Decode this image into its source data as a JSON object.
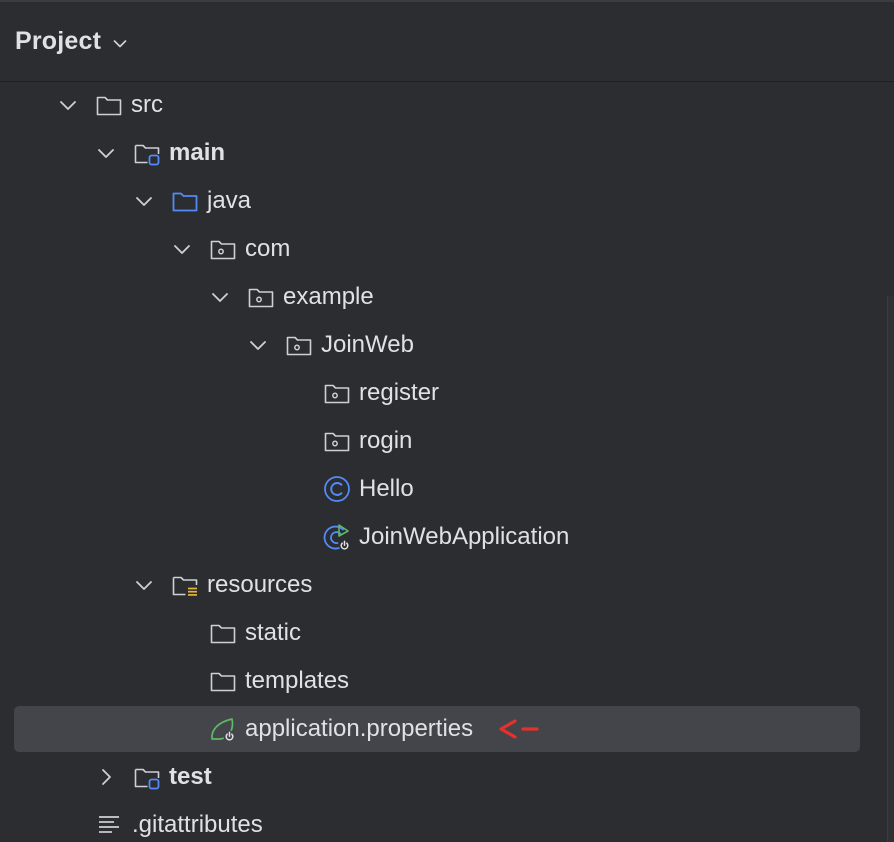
{
  "panel": {
    "title": "Project"
  },
  "tree": {
    "src": "src",
    "main": "main",
    "java": "java",
    "com": "com",
    "example": "example",
    "joinweb": "JoinWeb",
    "register": "register",
    "rogin": "rogin",
    "hello": "Hello",
    "joinwebapp": "JoinWebApplication",
    "resources": "resources",
    "static": "static",
    "templates": "templates",
    "app_props": "application.properties",
    "test": "test",
    "gitattributes": ".gitattributes"
  },
  "icons": {
    "folder": "folder-icon",
    "source_root": "source-root-folder-icon",
    "package": "package-icon",
    "module": "module-folder-icon",
    "resources_root": "resources-root-folder-icon",
    "class": "class-icon",
    "spring_app": "spring-boot-application-icon",
    "spring_props": "spring-properties-icon",
    "text_file": "text-file-icon"
  },
  "colors": {
    "background": "#2b2d30",
    "selection": "#43454a",
    "text": "#dfe1e5",
    "source_blue": "#548af7",
    "spring_green": "#5fb865",
    "resource_yellow": "#e5b53c",
    "annotation_red": "#e5312b"
  },
  "annotation": {
    "arrow_text": "<-"
  }
}
